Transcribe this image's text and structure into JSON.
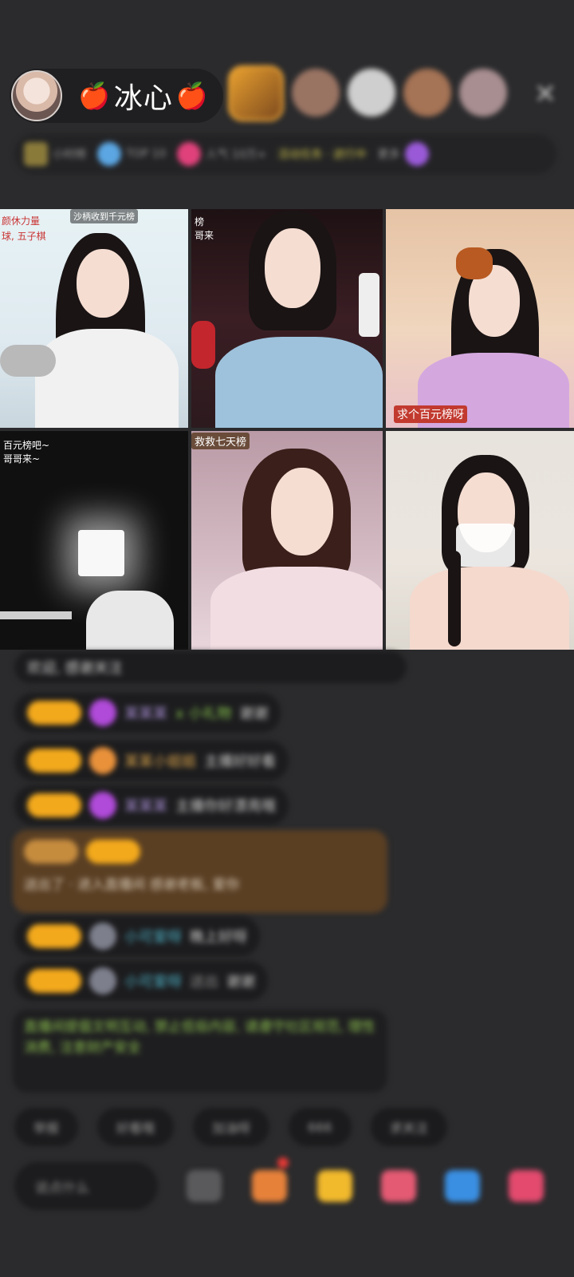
{
  "header": {
    "host_name": "冰心",
    "apple_emoji": "🍎",
    "close_symbol": "✕",
    "viewer_avatar_count": 5
  },
  "info_bar": {
    "items": [
      {
        "text": "小时榜"
      },
      {
        "text": "TOP 10"
      },
      {
        "text": "人气 10万+"
      },
      {
        "text": "活动任务 · 进行中"
      },
      {
        "text": "更多"
      }
    ]
  },
  "video_grid": [
    {
      "top_label": "沙柄收到千元榜",
      "left_text": "颜休力量\n球, 五子棋"
    },
    {
      "top_label": "榜\n哥来"
    },
    {
      "bottom_label": "求个百元榜呀"
    },
    {
      "top_label": "百元榜吧~\n哥哥来~"
    },
    {
      "top_label": "救救七天榜"
    },
    {}
  ],
  "chat": [
    {
      "text": "欢迎, 感谢关注"
    },
    {
      "user": "某某某",
      "extra": "x 小礼物",
      "msg": "谢谢"
    },
    {
      "user": "某某小姐姐",
      "msg": "主播好好看"
    },
    {
      "user": "某某某",
      "msg": "主播你好漂亮哦"
    },
    {
      "text": "送出了 · 进入直播间 感谢老板, 爱你"
    },
    {
      "user": "小可爱呀",
      "msg": "晚上好呀"
    },
    {
      "user": "小可爱呀",
      "extra": "送出",
      "msg": "谢谢"
    },
    {
      "text": "直播间提倡文明互动, 禁止低俗内容, 请遵守社区规范, 理性消费, 注意财产安全"
    }
  ],
  "pills": [
    "举报",
    "好看哦",
    "加油呀",
    "666",
    "求关注"
  ],
  "say_input": "说点什么",
  "colors": {
    "accent": "#f3a91c",
    "background": "#2b2b2d",
    "apple": "#e02a2a"
  }
}
